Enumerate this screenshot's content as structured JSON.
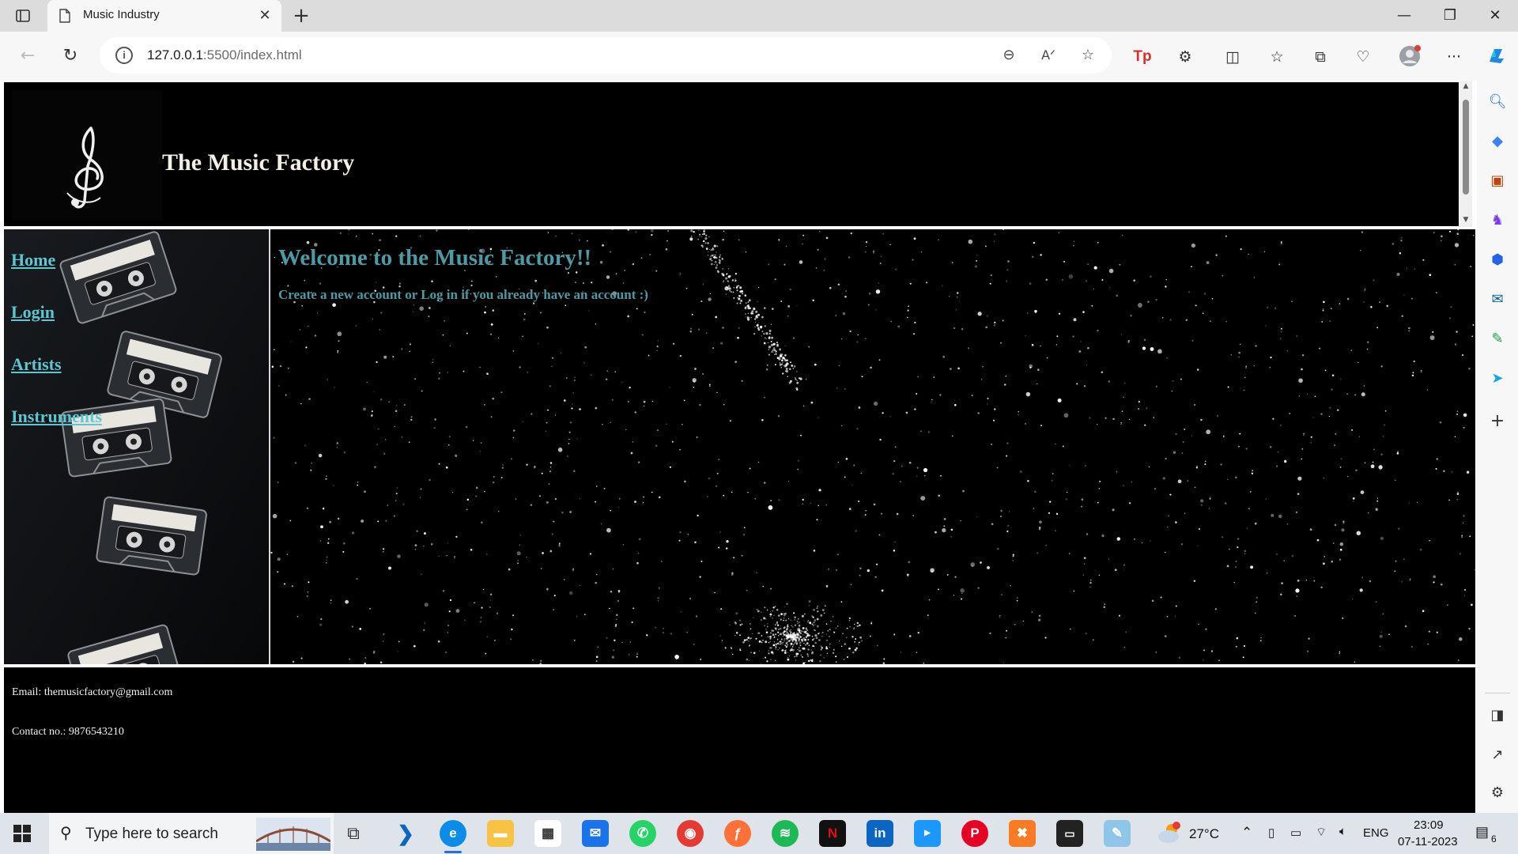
{
  "browser": {
    "tab_title": "Music Industry",
    "url_host": "127.0.0.1",
    "url_rest": ":5500/index.html"
  },
  "site": {
    "title": "The Music Factory",
    "nav": [
      {
        "label": "Home"
      },
      {
        "label": "Login"
      },
      {
        "label": "Artists"
      },
      {
        "label": "Instruments"
      }
    ],
    "welcome_heading": "Welcome to the Music Factory!!",
    "welcome_subtext": "Create a new account or Log in if you already have an account :)",
    "footer": {
      "email": "Email: themusicfactory@gmail.com",
      "contact": "Contact no.: 9876543210"
    }
  },
  "taskbar": {
    "search_placeholder": "Type here to search",
    "weather": "27°C",
    "language": "ENG",
    "time": "23:09",
    "date": "07-11-2023",
    "notifications": "6"
  },
  "colors": {
    "nav_link": "#5ec6d0",
    "welcome_text": "#4d9aa4",
    "page_bg": "#000000"
  }
}
